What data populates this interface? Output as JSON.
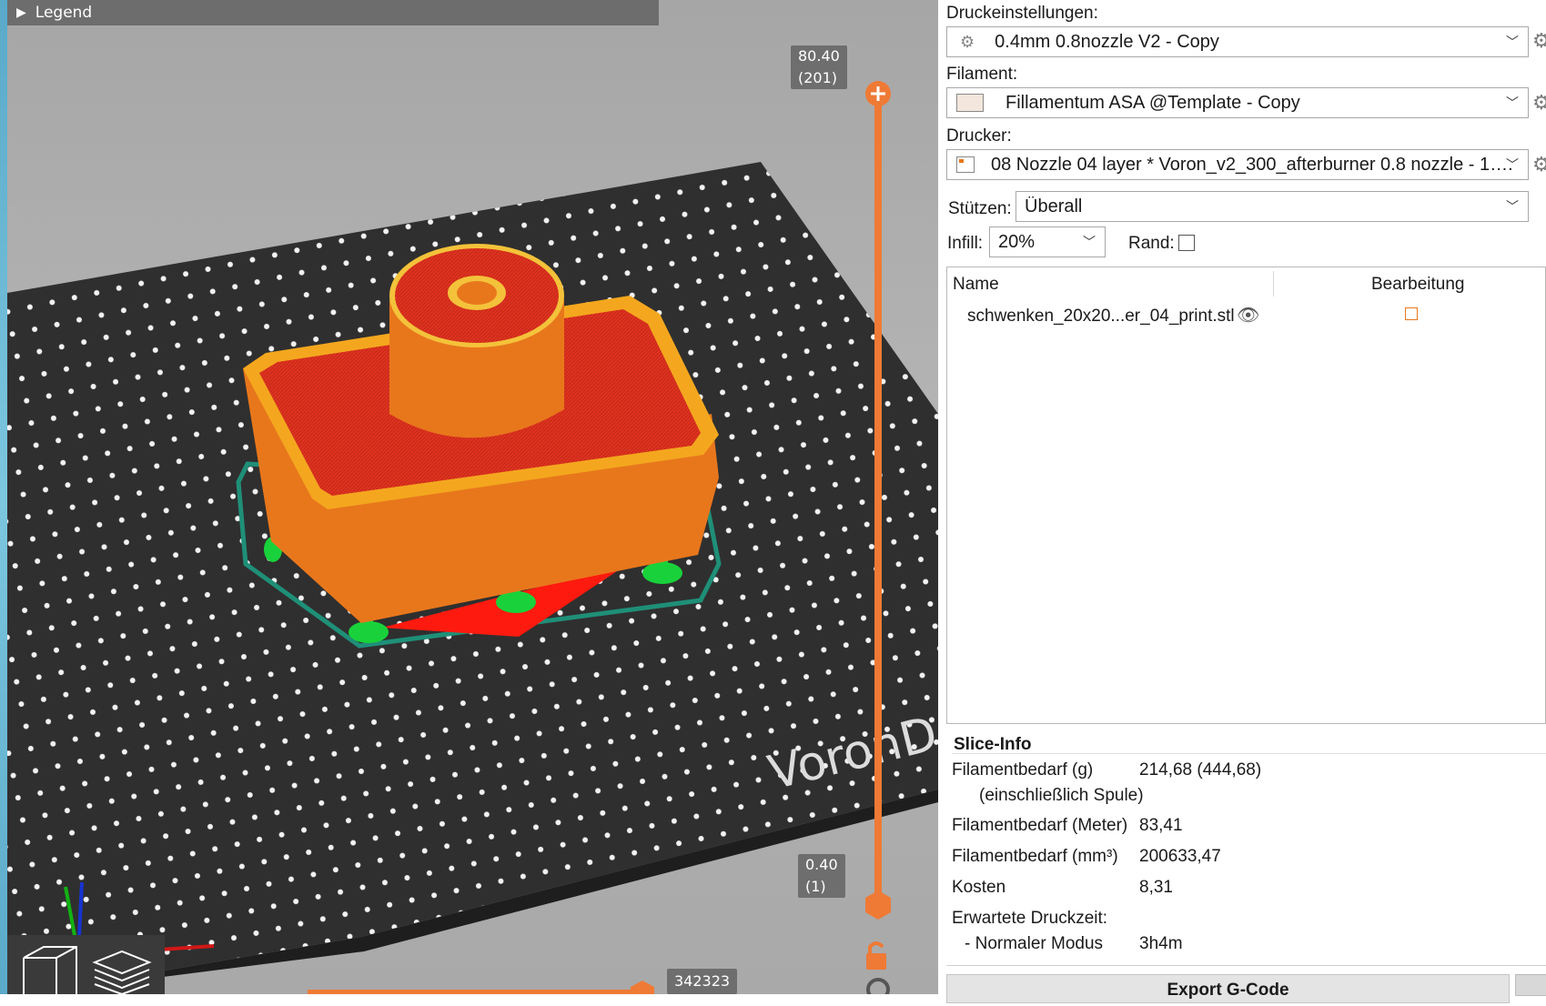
{
  "viewport": {
    "legend_label": "Legend",
    "slider_top_value": "80.40",
    "slider_top_layer": "(201)",
    "slider_bottom_value": "0.40",
    "slider_bottom_layer": "(1)",
    "horizontal_slider_value": "342323",
    "bed_logo_text": "VoronD"
  },
  "panel": {
    "print_settings": {
      "label": "Druckeinstellungen:",
      "value": "0.4mm 0.8nozzle V2 - Copy"
    },
    "filament": {
      "label": "Filament:",
      "value": "Fillamentum ASA @Template - Copy"
    },
    "printer": {
      "label": "Drucker:",
      "value": "08 Nozzle 04 layer * Voron_v2_300_afterburner 0.8 nozzle - 1…."
    },
    "supports": {
      "label": "Stützen:",
      "value": "Überall"
    },
    "infill": {
      "label": "Infill:",
      "value": "20%"
    },
    "brim": {
      "label": "Rand:",
      "checked": false
    },
    "objects": {
      "col_name": "Name",
      "col_edit": "Bearbeitung",
      "rows": [
        {
          "name": "schwenken_20x20...er_04_print.stl"
        }
      ]
    },
    "slice_info": {
      "title": "Slice-Info",
      "filament_g_label": "Filamentbedarf (g)",
      "filament_g_sub": "(einschließlich Spule)",
      "filament_g_value": "214,68 (444,68)",
      "filament_m_label": "Filamentbedarf (Meter)",
      "filament_m_value": "83,41",
      "filament_mm3_label": "Filamentbedarf (mm³)",
      "filament_mm3_value": "200633,47",
      "cost_label": "Kosten",
      "cost_value": "8,31",
      "time_label": "Erwartete Druckzeit:",
      "mode_label": "- Normaler Modus",
      "mode_value": "3h4m"
    },
    "export_label": "Export G-Code"
  }
}
